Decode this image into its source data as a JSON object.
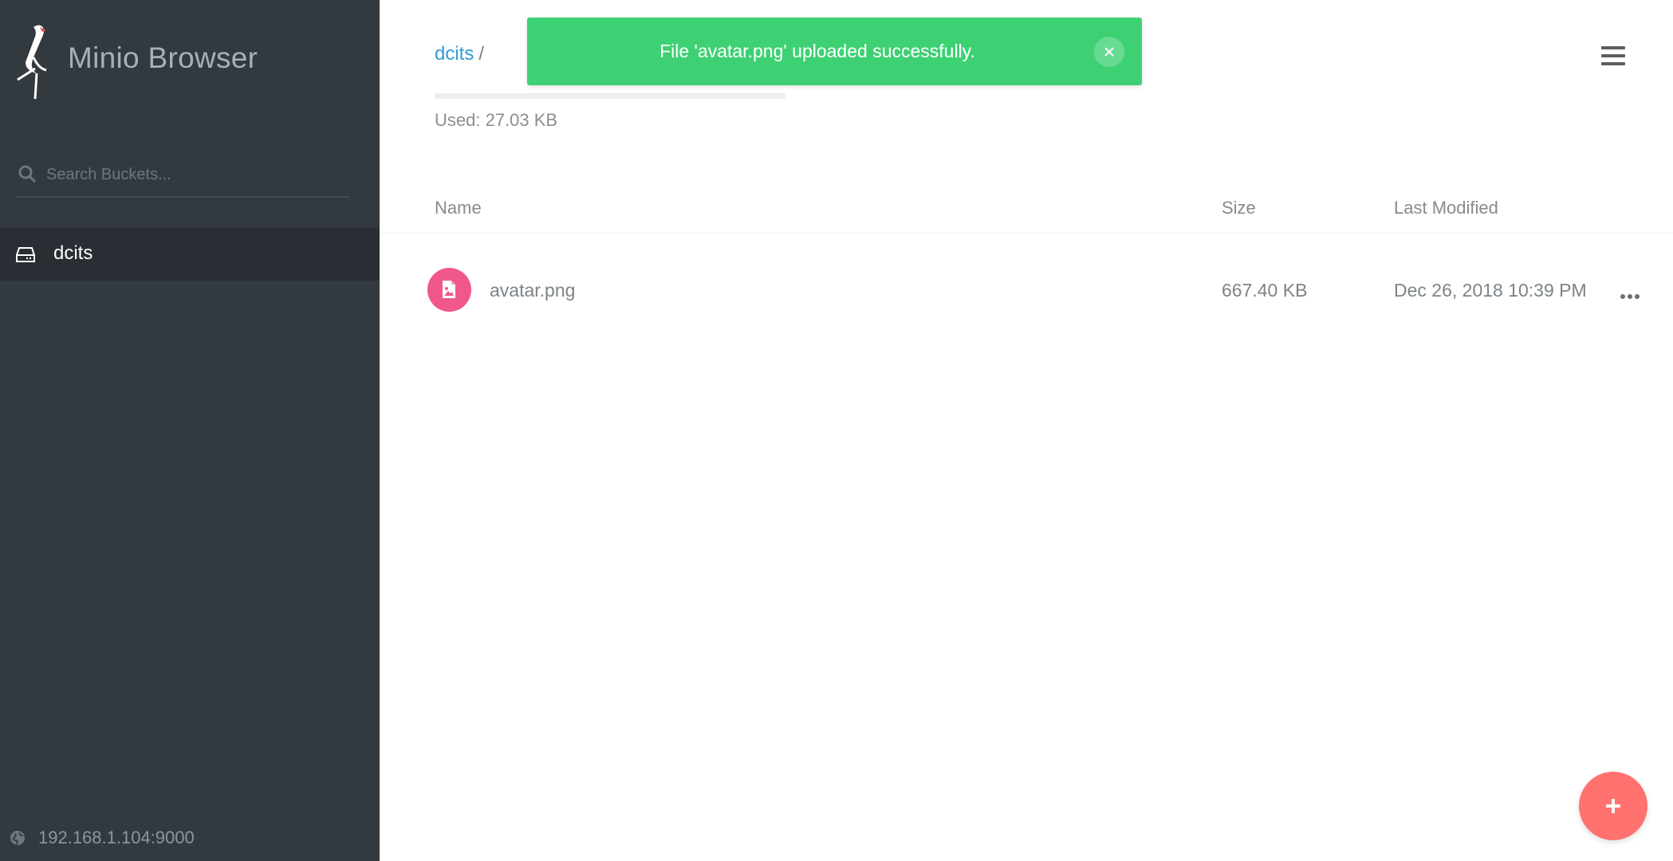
{
  "app": {
    "title": "Minio Browser"
  },
  "sidebar": {
    "search": {
      "placeholder": "Search Buckets..."
    },
    "buckets": [
      {
        "label": "dcits",
        "icon": "hard-drive-icon",
        "active": true
      }
    ],
    "host": {
      "label": "192.168.1.104:9000",
      "icon": "globe-icon"
    }
  },
  "main": {
    "breadcrumb": {
      "bucket": "dcits",
      "separator": "/"
    },
    "usage": {
      "text": "Used: 27.03 KB",
      "fraction": 0.0
    },
    "table": {
      "headers": {
        "name": "Name",
        "size": "Size",
        "modified": "Last Modified"
      },
      "rows": [
        {
          "name": "avatar.png",
          "size": "667.40 KB",
          "modified": "Dec 26, 2018 10:39 PM",
          "icon": "image-file-icon"
        }
      ]
    },
    "menu_icon": "hamburger-menu-icon",
    "fab_icon": "plus-icon"
  },
  "toast": {
    "message": "File 'avatar.png' uploaded successfully.",
    "close_icon": "close-icon"
  },
  "colors": {
    "sidebar_bg": "#32393f",
    "active_bucket_bg": "#282e33",
    "link": "#2e9bd6",
    "toast_bg": "#3ed174",
    "fab_bg": "#ff726f",
    "file_icon_bg": "#f0588c"
  }
}
